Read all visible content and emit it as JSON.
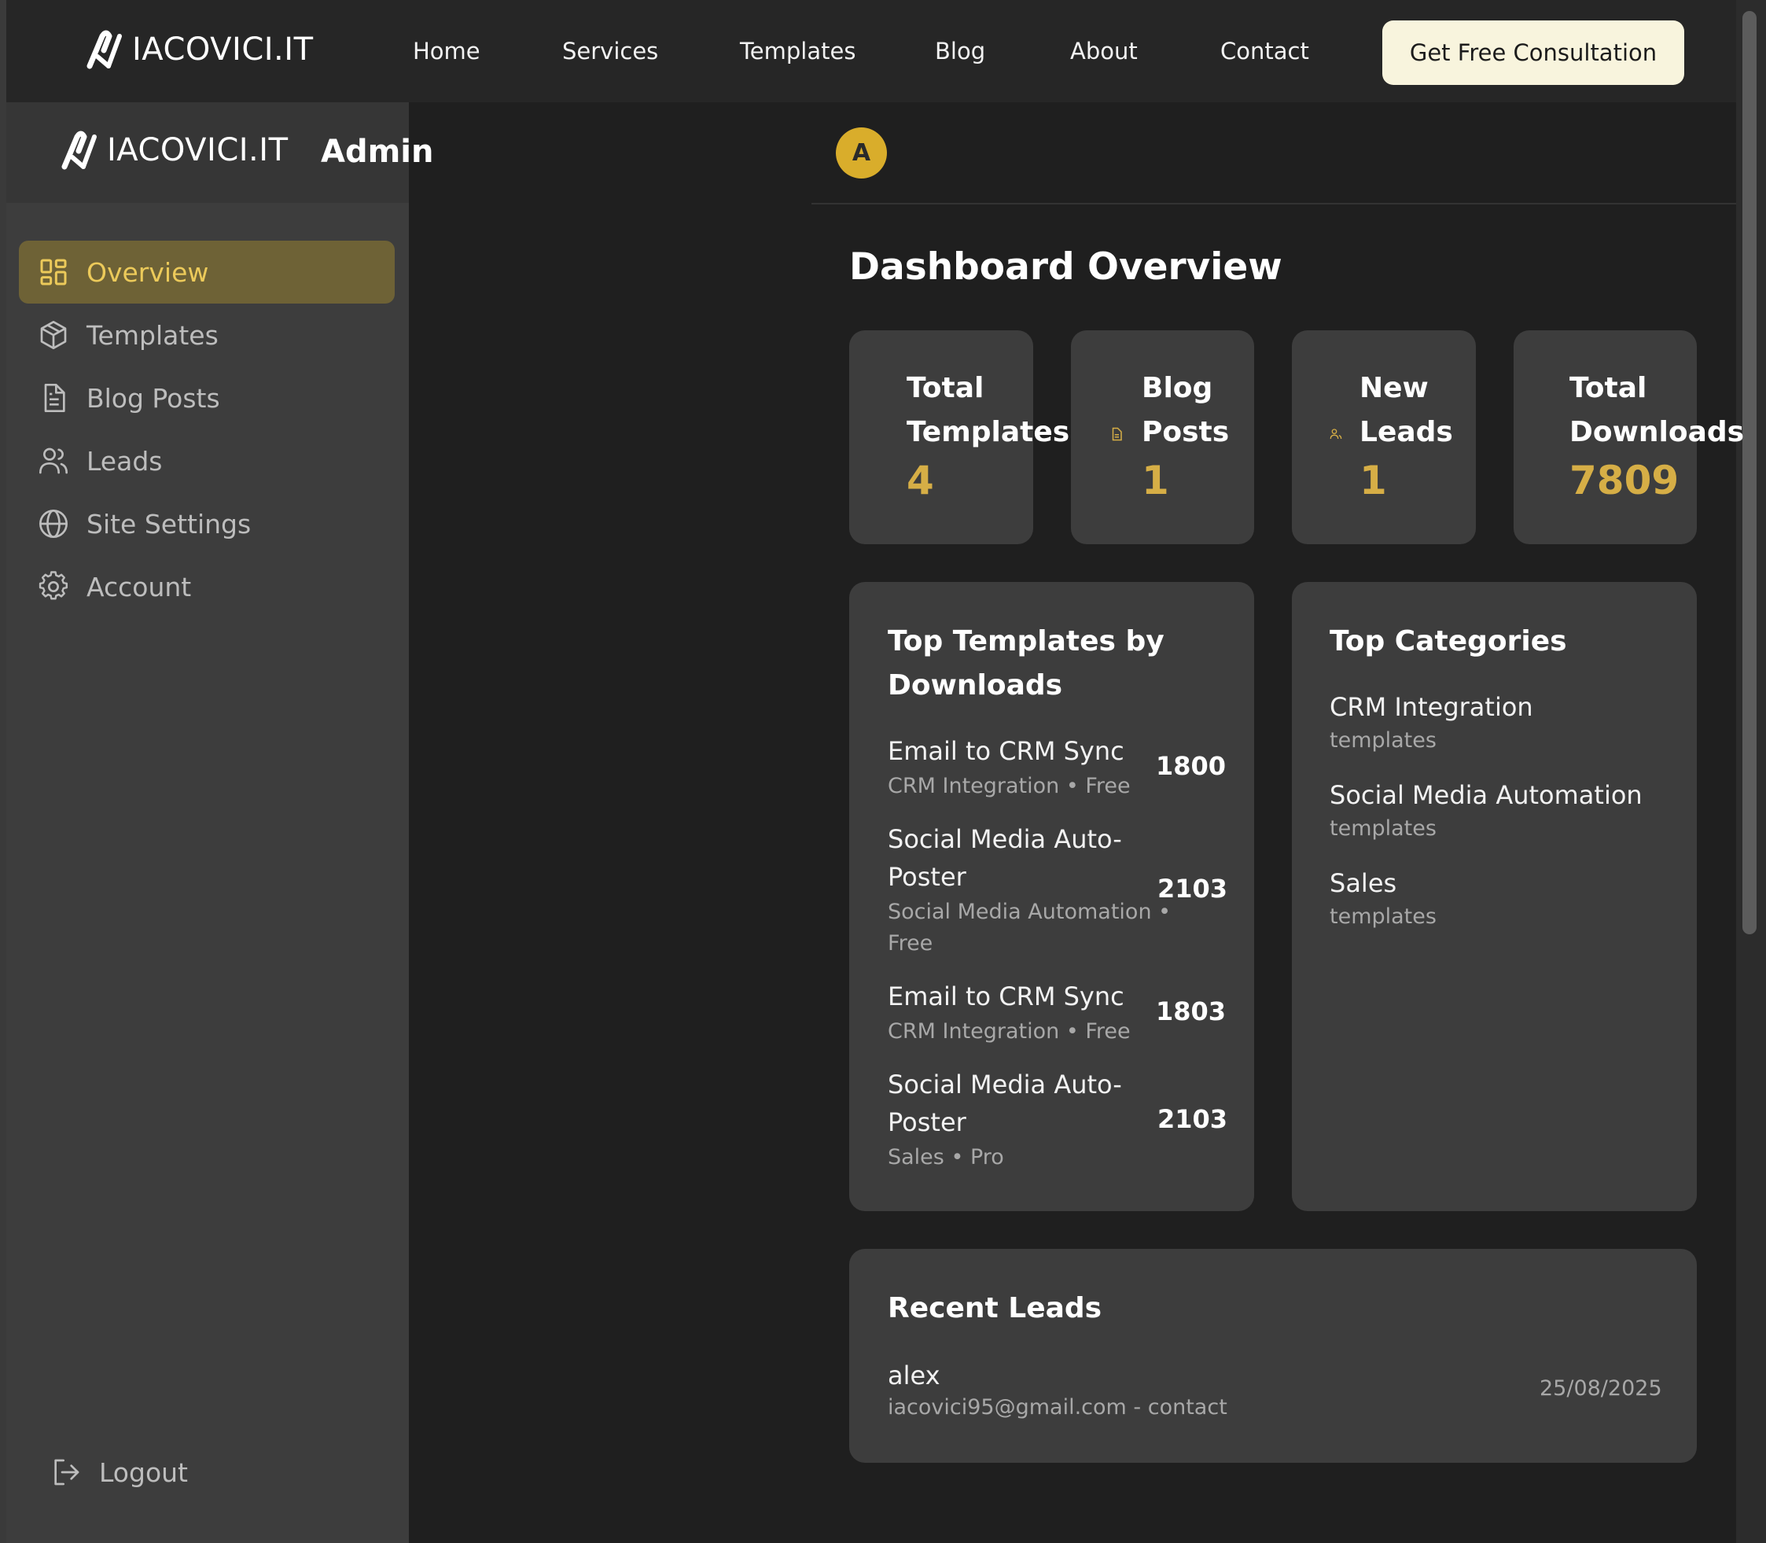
{
  "brand": {
    "logo_text": "IACOVICI.IT"
  },
  "topnav": {
    "links": [
      "Home",
      "Services",
      "Templates",
      "Blog",
      "About",
      "Contact"
    ],
    "cta_label": "Get Free Consultation"
  },
  "sidebar": {
    "logo_text": "IACOVICI.IT",
    "admin_label": "Admin",
    "items": [
      {
        "label": "Overview",
        "icon": "grid-icon",
        "active": true
      },
      {
        "label": "Templates",
        "icon": "box-icon",
        "active": false
      },
      {
        "label": "Blog Posts",
        "icon": "document-icon",
        "active": false
      },
      {
        "label": "Leads",
        "icon": "users-icon",
        "active": false
      },
      {
        "label": "Site Settings",
        "icon": "globe-icon",
        "active": false
      },
      {
        "label": "Account",
        "icon": "gear-icon",
        "active": false
      }
    ],
    "logout_label": "Logout"
  },
  "header": {
    "avatar_initial": "A"
  },
  "dashboard": {
    "title": "Dashboard Overview",
    "stats": [
      {
        "label_line1": "Total",
        "label_line2": "Templates",
        "value": "4"
      },
      {
        "label_line1": "Blog",
        "label_line2": "Posts",
        "value": "1",
        "icon": "document-icon"
      },
      {
        "label_line1": "New",
        "label_line2": "Leads",
        "value": "1",
        "icon": "users-icon"
      },
      {
        "label_line1": "Total",
        "label_line2": "Downloads",
        "value": "7809"
      }
    ],
    "top_templates": {
      "title_line1": "Top Templates by",
      "title_line2": "Downloads",
      "items": [
        {
          "name_line1": "Email to CRM Sync",
          "name_line2": "",
          "meta_line1": "CRM Integration • Free",
          "meta_line2": "",
          "count": "1800"
        },
        {
          "name_line1": "Social Media Auto-",
          "name_line2": "Poster",
          "meta_line1": "Social Media Automation •",
          "meta_line2": "Free",
          "count": "2103"
        },
        {
          "name_line1": "Email to CRM Sync",
          "name_line2": "",
          "meta_line1": "CRM Integration • Free",
          "meta_line2": "",
          "count": "1803"
        },
        {
          "name_line1": "Social Media Auto-",
          "name_line2": "Poster",
          "meta_line1": "Sales • Pro",
          "meta_line2": "",
          "count": "2103"
        }
      ]
    },
    "top_categories": {
      "title": "Top Categories",
      "items": [
        {
          "name": "CRM Integration",
          "sub": "templates"
        },
        {
          "name": "Social Media Automation",
          "sub": "templates"
        },
        {
          "name": "Sales",
          "sub": "templates"
        }
      ]
    },
    "recent_leads": {
      "title": "Recent Leads",
      "items": [
        {
          "name": "alex",
          "detail": "iacovici95@gmail.com - contact",
          "date": "25/08/2025"
        }
      ]
    }
  },
  "colors": {
    "accent": "#d6ae46",
    "active_bg": "#6e6236",
    "cta_bg": "#f8f4dd",
    "page_bg": "#1f1f1f",
    "card_bg": "#3d3d3d"
  }
}
